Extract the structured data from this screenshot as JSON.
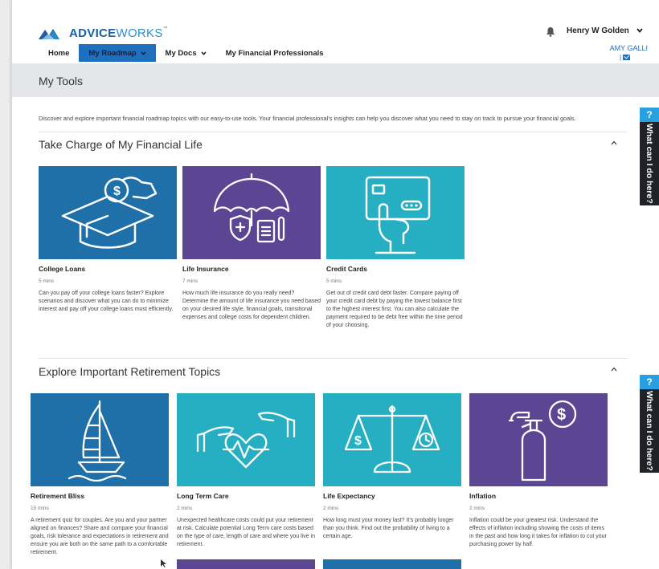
{
  "header": {
    "logo_bold": "ADVICE",
    "logo_light": "WORKS",
    "logo_tm": "™",
    "user_name": "Henry W Golden",
    "advisor_name": "AMY GALLI",
    "advisor_mail_sep": "|"
  },
  "nav": {
    "items": [
      {
        "label": "Home"
      },
      {
        "label": "My Roadmap"
      },
      {
        "label": "My Docs"
      },
      {
        "label": "My Financial Professionals"
      }
    ]
  },
  "page": {
    "title": "My Tools",
    "intro": "Discover and explore important financial roadmap topics with our easy-to-use tools. Your financial professional’s insights can help you discover what you need to stay on track to pursue your financial goals."
  },
  "sections": [
    {
      "title": "Take Charge of My Financial Life",
      "cards": [
        {
          "title": "College Loans",
          "time": "5 mins",
          "desc": "Can you pay off your college loans faster? Explore scenarios and discover what you can do to minimize interest and pay off your college loans most efficiently."
        },
        {
          "title": "Life Insurance",
          "time": "7 mins",
          "desc": "How much life insurance do you really need? Determine the amount of life insurance you need based on your desired life style, financial goals, transitional expenses and college costs for dependent children."
        },
        {
          "title": "Credit Cards",
          "time": "5 mins",
          "desc": "Get out of credit card debt faster. Compare paying off your credit card debt by paying the lowest balance first to the highest interest first. You can also calculate the payment required to be debt free within the time period of your choosing."
        }
      ]
    },
    {
      "title": "Explore Important Retirement Topics",
      "cards": [
        {
          "title": "Retirement Bliss",
          "time": "15 mins",
          "desc": "A retirement quiz for couples. Are you and your partner aligned on finances? Share and compare your financial goals, risk tolerance and expectations in retirement and ensure you are both on the same path to a comfortable retirement."
        },
        {
          "title": "Long Term Care",
          "time": "2 mins",
          "desc": "Unexpected healthcare costs could put your retirement at risk. Calculate potential Long Term care costs based on the type of care, length of care and where you live in retirement."
        },
        {
          "title": "Life Expectancy",
          "time": "2 mins",
          "desc": "How long must your money last? It’s probably longer than you think. Find out the probability of living to a certain age."
        },
        {
          "title": "Inflation",
          "time": "2 mins",
          "desc": "Inflation could be your greatest risk. Understand the effects of inflation including showing the costs of items in the past and how long it takes for inflation to cut your purchasing power by half."
        }
      ]
    }
  ],
  "help": {
    "q": "?",
    "label": "What can I do here?"
  },
  "colors": {
    "blue": "#1f6fa8",
    "purple": "#5c4593",
    "teal": "#26aec3",
    "nav_active": "#1f6fbf",
    "help_q": "#29a0e0",
    "help_bg": "#1f2227"
  }
}
